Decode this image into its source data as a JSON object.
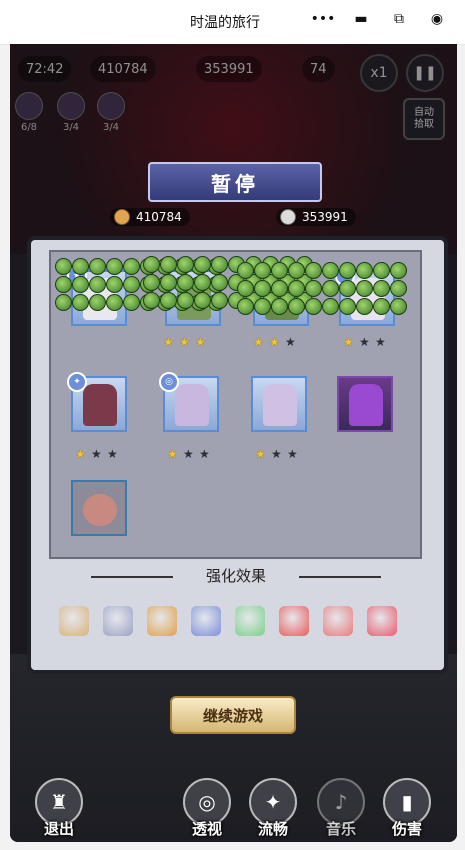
{
  "window": {
    "title": "时温的旅行",
    "icons": [
      "more-dots-icon",
      "minimize-icon",
      "restore-icon",
      "close-record-icon"
    ]
  },
  "hud": {
    "timer": "72:42",
    "coins_top": "410784",
    "kills_top": "353991",
    "wave": "74",
    "speed": "x1",
    "auto_label": "自动\n拾取",
    "skills": [
      {
        "level": "6/8"
      },
      {
        "level": "3/4"
      },
      {
        "level": "3/4"
      }
    ]
  },
  "pause": {
    "title": "暂停",
    "coins": "410784",
    "kills": "353991"
  },
  "heroes": [
    {
      "stars": 1,
      "row": 0
    },
    {
      "stars": 3,
      "row": 0
    },
    {
      "stars": 2,
      "row": 0
    },
    {
      "stars": 1,
      "row": 0
    },
    {
      "stars": 1,
      "row": 1
    },
    {
      "stars": 1,
      "row": 1
    },
    {
      "stars": 1,
      "row": 1
    },
    {
      "stars": 0,
      "row": 1
    }
  ],
  "effects_title": "强化效果",
  "effects": [
    {
      "icon": "bee-icon",
      "color": "#d8b27a"
    },
    {
      "icon": "crossed-swords-icon",
      "color": "#9aa2c4"
    },
    {
      "icon": "gold-disc-icon",
      "color": "#e0a04a"
    },
    {
      "icon": "sword-icon",
      "color": "#7a8fd6"
    },
    {
      "icon": "green-gear-icon",
      "color": "#7ad08a"
    },
    {
      "icon": "red-shield-icon",
      "color": "#e85a5a"
    },
    {
      "icon": "red-blade-icon",
      "color": "#e87a7a"
    },
    {
      "icon": "red-emblem-icon",
      "color": "#e85a6a"
    }
  ],
  "continue_label": "继续游戏",
  "bottom": {
    "exit": "退出",
    "perspective": "透视",
    "smooth": "流畅",
    "music": "音乐",
    "damage": "伤害"
  }
}
